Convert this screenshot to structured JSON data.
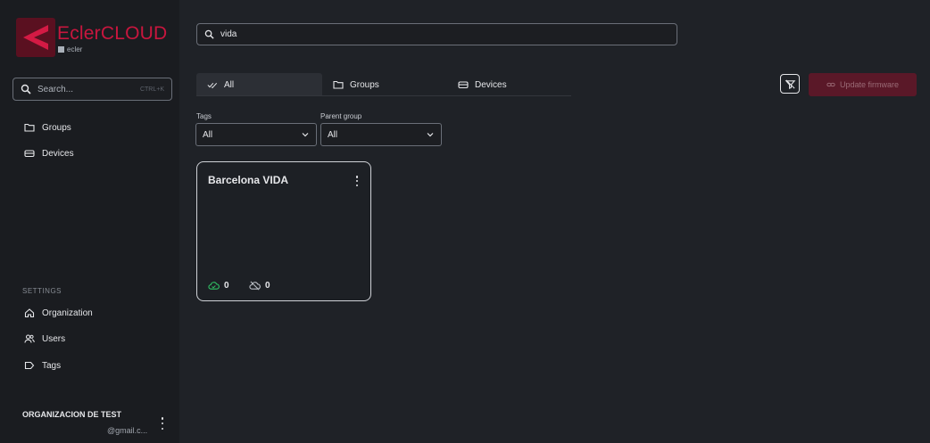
{
  "brand": {
    "title": "EclerCLOUD",
    "subtitle": "ecler",
    "accent_color": "#c8163e"
  },
  "sidebar": {
    "search": {
      "placeholder": "Search...",
      "shortcut": "CTRL+K",
      "icon": "search-icon"
    },
    "nav": [
      {
        "label": "Groups",
        "icon": "folder-icon"
      },
      {
        "label": "Devices",
        "icon": "device-icon"
      }
    ],
    "settings_label": "SETTINGS",
    "settings": [
      {
        "label": "Organization",
        "icon": "home-icon"
      },
      {
        "label": "Users",
        "icon": "users-icon"
      },
      {
        "label": "Tags",
        "icon": "tag-icon"
      }
    ],
    "organization": {
      "name": "ORGANIZACION DE TEST",
      "email": "@gmail.c..."
    }
  },
  "search": {
    "value": "vida",
    "icon": "search-icon"
  },
  "tabs": [
    {
      "label": "All",
      "icon": "check-all-icon",
      "active": true
    },
    {
      "label": "Groups",
      "icon": "folder-icon",
      "active": false
    },
    {
      "label": "Devices",
      "icon": "device-icon",
      "active": false
    }
  ],
  "toolbar": {
    "filter_icon": "filter-off-icon",
    "update_label": "Update firmware",
    "update_color": "#5a1828"
  },
  "filters": {
    "tags": {
      "label": "Tags",
      "value": "All"
    },
    "parent_group": {
      "label": "Parent group",
      "value": "All"
    }
  },
  "cards": [
    {
      "title": "Barcelona VIDA",
      "online": "0",
      "offline": "0",
      "online_color": "#2fbf63"
    }
  ]
}
